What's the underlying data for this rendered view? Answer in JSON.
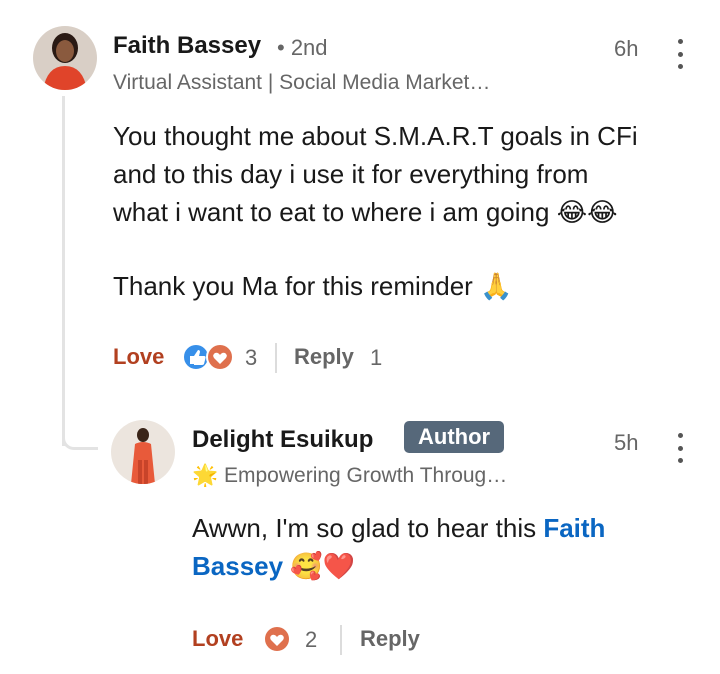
{
  "comment": {
    "author_name": "Faith Bassey",
    "degree": "• 2nd",
    "time": "6h",
    "headline": "Virtual Assistant | Social Media Market…",
    "body_line1": "You thought me about S.M.A.R.T goals in CFi",
    "body_line2": "and to this day i use it for everything from",
    "body_line3": "what i want to eat to where i am going 😂😂",
    "body_line4": "Thank you Ma for this reminder 🙏",
    "love_label": "Love",
    "reaction_count": "3",
    "reply_label": "Reply",
    "reply_count": "1"
  },
  "reply": {
    "author_name": "Delight Esuikup",
    "author_badge": "Author",
    "time": "5h",
    "headline_emoji": "🌟",
    "headline": "Empowering Growth Throug…",
    "body_prefix": "Awwn, I'm so glad to hear this ",
    "mention_first": "Faith",
    "mention_last": "Bassey",
    "body_suffix": " 🥰❤️",
    "love_label": "Love",
    "reaction_count": "2",
    "reply_label": "Reply"
  },
  "colors": {
    "love_accent": "#b24020",
    "mention_blue": "#0a66c2",
    "author_badge_bg": "#56687a",
    "like_blue": "#378fe9",
    "heart_red": "#df704d"
  }
}
